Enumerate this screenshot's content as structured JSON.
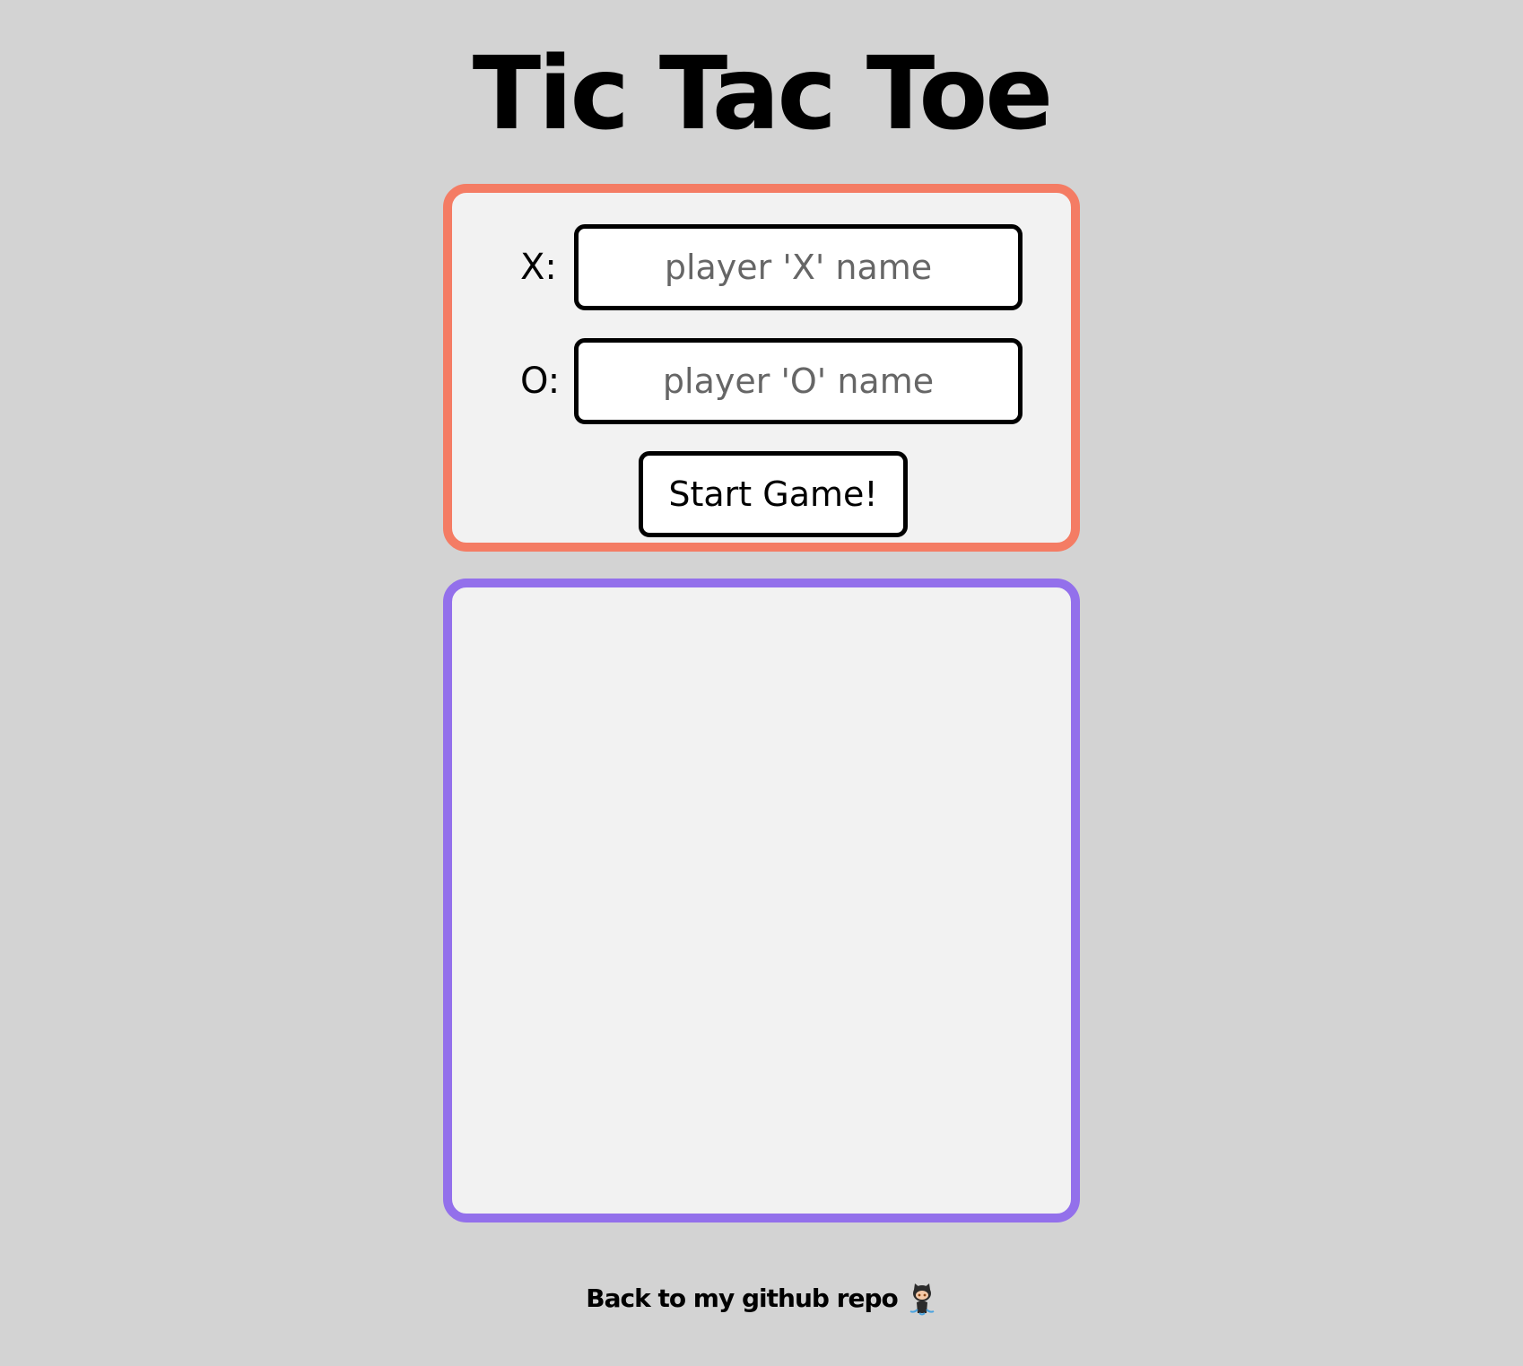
{
  "page": {
    "title": "Tic Tac Toe"
  },
  "setup": {
    "player_x": {
      "label": "X:",
      "placeholder": "player 'X' name",
      "value": ""
    },
    "player_o": {
      "label": "O:",
      "placeholder": "player 'O' name",
      "value": ""
    },
    "start_label": "Start Game!"
  },
  "board": {
    "cells": []
  },
  "footer": {
    "link_text": "Back to my github repo",
    "icon": "octocat-icon"
  },
  "colors": {
    "background": "#d3d3d3",
    "panel": "#f2f2f2",
    "setup_border": "#f47c64",
    "board_border": "#9370eb"
  }
}
